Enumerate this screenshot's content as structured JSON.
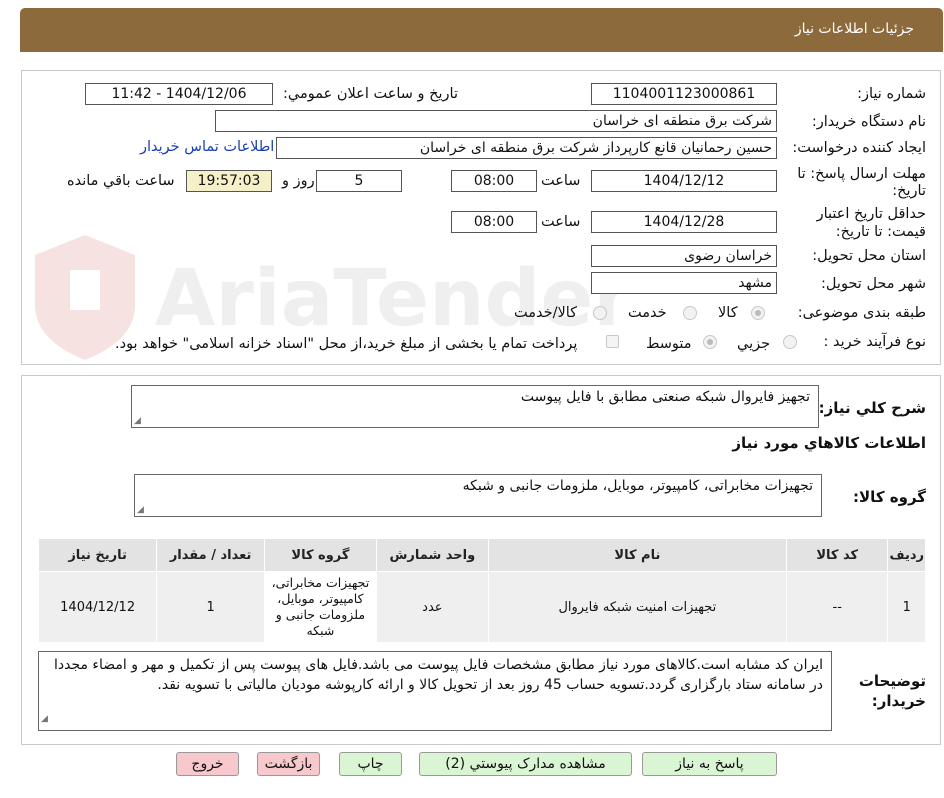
{
  "header": {
    "title": "جزئیات اطلاعات نیاز"
  },
  "watermark": {
    "text": "AriaTender.neT"
  },
  "form": {
    "need_number_label": "شماره نیاز:",
    "need_number": "1104001123000861",
    "announce_label": "تاریخ و ساعت اعلان عمومي:",
    "announce_value": "1404/12/06 - 11:42",
    "buyer_org_label": "نام دستگاه خريدار:",
    "buyer_org": "شرکت برق منطقه ای خراسان",
    "requester_label": "ايجاد کننده درخواست:",
    "requester": "حسین رحمانیان قانع کارپرداز شرکت برق منطقه ای خراسان",
    "contact_link": "اطلاعات تماس خريدار",
    "deadline_label_1": "مهلت ارسال پاسخ: تا",
    "deadline_label_2": "تاريخ:",
    "deadline_date": "1404/12/12",
    "time_word": "ساعت",
    "deadline_time": "08:00",
    "days_left": "5",
    "day_word": "روز و",
    "time_left": "19:57:03",
    "remaining_word": "ساعت باقي مانده",
    "validity_label_1": "حداقل تاريخ اعتبار",
    "validity_label_2": "قيمت: تا تاريخ:",
    "validity_date": "1404/12/28",
    "validity_time": "08:00",
    "province_label": "استان محل تحويل:",
    "province": "خراسان رضوی",
    "city_label": "شهر محل تحويل:",
    "city": "مشهد",
    "category_label": "طبقه بندی موضوعی:",
    "category_options": [
      "کالا",
      "خدمت",
      "کالا/خدمت"
    ],
    "process_label": "نوع فرآيند خريد :",
    "process_options": [
      "جزيي",
      "متوسط"
    ],
    "payment_note": "پرداخت تمام يا بخشی از مبلغ خريد،از محل \"اسناد خزانه اسلامی\" خواهد بود."
  },
  "summary": {
    "general_label": "شرح کلي نياز:",
    "general_text": "تجهیز فایروال شبکه صنعتی مطابق با فایل پیوست",
    "goods_info_title": "اطلاعات کالاهاي مورد نياز",
    "goods_group_label": "گروه کالا:",
    "goods_group_text": "تجهیزات مخابراتی، کامپیوتر، موبایل، ملزومات جانبی و شبکه"
  },
  "table": {
    "headers": [
      "رديف",
      "کد کالا",
      "نام کالا",
      "واحد شمارش",
      "گروه کالا",
      "تعداد / مقدار",
      "تاريخ نياز"
    ],
    "rows": [
      [
        "1",
        "--",
        "تجهیزات امنیت شبکه فایروال",
        "عدد",
        "تجهیزات مخابراتی، کامپیوتر، موبایل، ملزومات جانبی و شبکه",
        "1",
        "1404/12/12"
      ]
    ]
  },
  "notes": {
    "label_1": "توضيحات",
    "label_2": "خريدار:",
    "text": "ایران کد مشابه است.کالاهای مورد نیاز مطابق مشخصات فایل پیوست می باشد.فایل های پیوست پس از تکمیل و مهر و امضاء مجددا در سامانه ستاد بارگزاری گردد.تسویه حساب 45 روز بعد از تحویل کالا و ارائه کارپوشه مودیان مالیاتی با تسویه نقد."
  },
  "buttons": {
    "reply": "پاسخ به نياز",
    "attachments": "مشاهده مدارک پيوستي (2)",
    "print": "چاپ",
    "back": "بازگشت",
    "exit": "خروج"
  }
}
